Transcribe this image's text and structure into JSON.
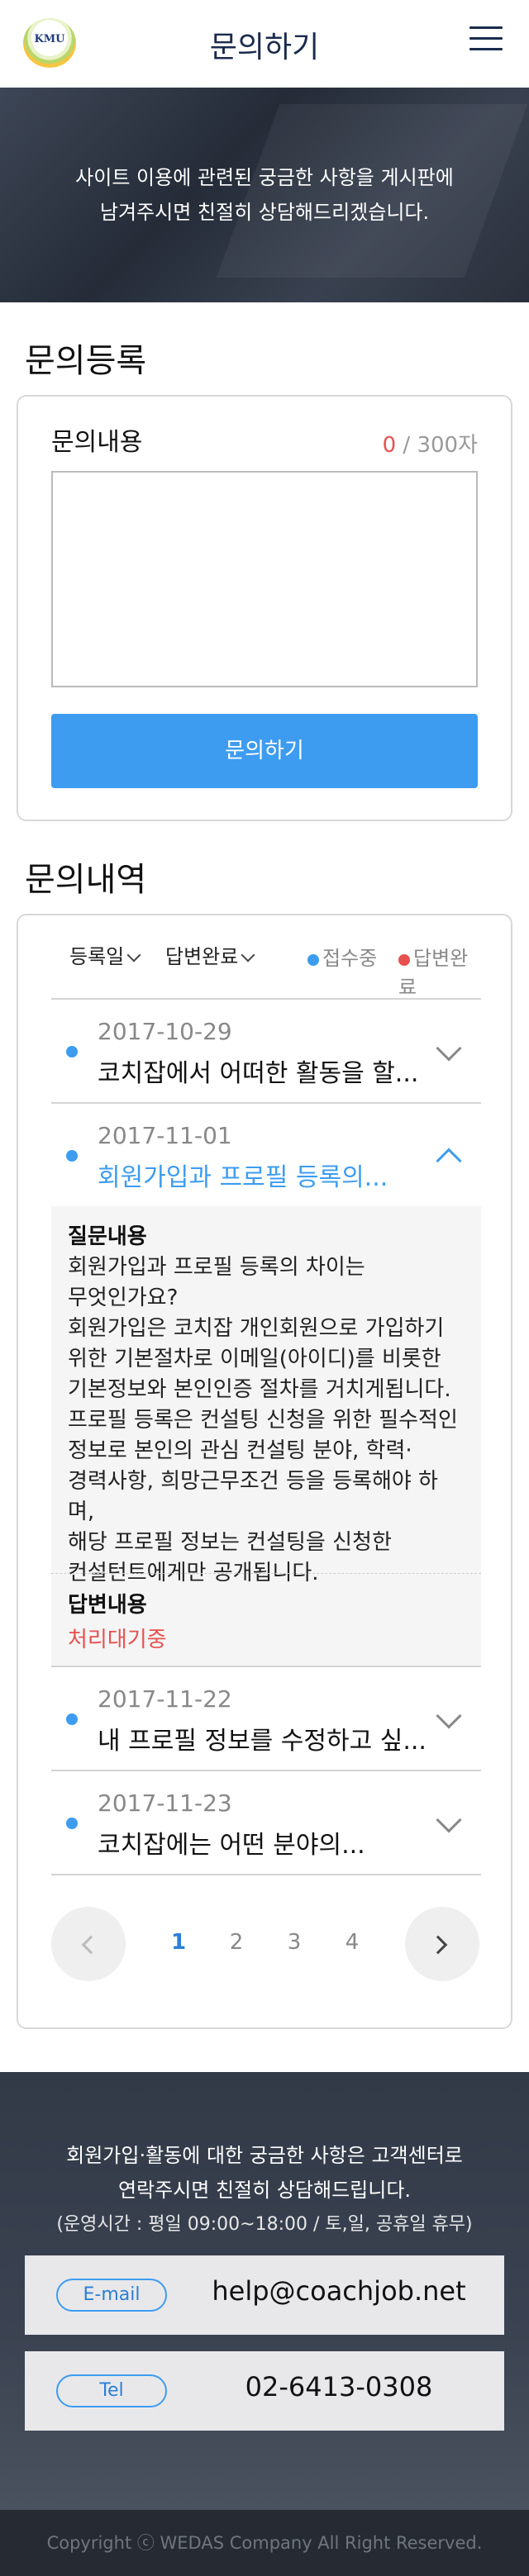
{
  "header": {
    "logo_text": "KMU",
    "title": "문의하기"
  },
  "hero": {
    "line1": "사이트 이용에 관련된 궁금한 사항을 게시판에",
    "line2": "남겨주시면 친절히 상담해드리겠습니다."
  },
  "register": {
    "section_title": "문의등록",
    "field_label": "문의내용",
    "count_current": "0",
    "count_max": " / 300자",
    "textarea_value": "",
    "submit_label": "문의하기"
  },
  "history": {
    "section_title": "문의내역",
    "filters": {
      "sort_label": "등록일",
      "status_label": "답변완료"
    },
    "legend": [
      {
        "label": "접수중",
        "color": "#3d9cf0"
      },
      {
        "label": "답변완료",
        "color": "#e8504f"
      }
    ],
    "items": [
      {
        "date": "2017-10-29",
        "title": "코치잡에서 어떠한 활동을 할..."
      },
      {
        "date": "2017-11-01",
        "title": "회원가입과 프로필 등록의..."
      },
      {
        "date": "2017-11-22",
        "title": "내 프로필 정보를 수정하고 싶..."
      },
      {
        "date": "2017-11-23",
        "title": "코치잡에는 어떤 분야의..."
      }
    ],
    "expanded": {
      "question_label": "질문내용",
      "question_lines": [
        "회원가입과 프로필 등록의 차이는",
        "무엇인가요?",
        "회원가입은 코치잡 개인회원으로 가입하기",
        "위한 기본절차로 이메일(아이디)를 비롯한",
        "기본정보와 본인인증 절차를 거치게됩니다.",
        "프로필 등록은 컨설팅 신청을 위한 필수적인",
        "정보로 본인의 관심 컨설팅 분야, 학력·",
        "경력사항, 희망근무조건 등을 등록해야 하며,",
        "해당 프로필 정보는 컨설팅을 신청한",
        "컨설턴트에게만 공개됩니다."
      ],
      "answer_label": "답변내용",
      "answer_status": "처리대기중"
    },
    "pagination": {
      "pages": [
        "1",
        "2",
        "3",
        "4"
      ],
      "current": "1"
    }
  },
  "footer": {
    "line1": "회원가입·활동에 대한 궁금한 사항은 고객센터로",
    "line2": "연락주시면 친절히 상담해드립니다.",
    "hours": "(운영시간 : 평일 09:00~18:00 / 토,일, 공휴일 휴무)",
    "email_label": "E-mail",
    "email": "help@coachjob.net",
    "tel_label": "Tel",
    "tel": "02-6413-0308",
    "copyright": "Copyright ⓒ WEDAS Company All Right Reserved."
  },
  "colors": {
    "accent": "#3d9cf0",
    "pending": "#e8504f",
    "title": "#1a2b4c"
  }
}
